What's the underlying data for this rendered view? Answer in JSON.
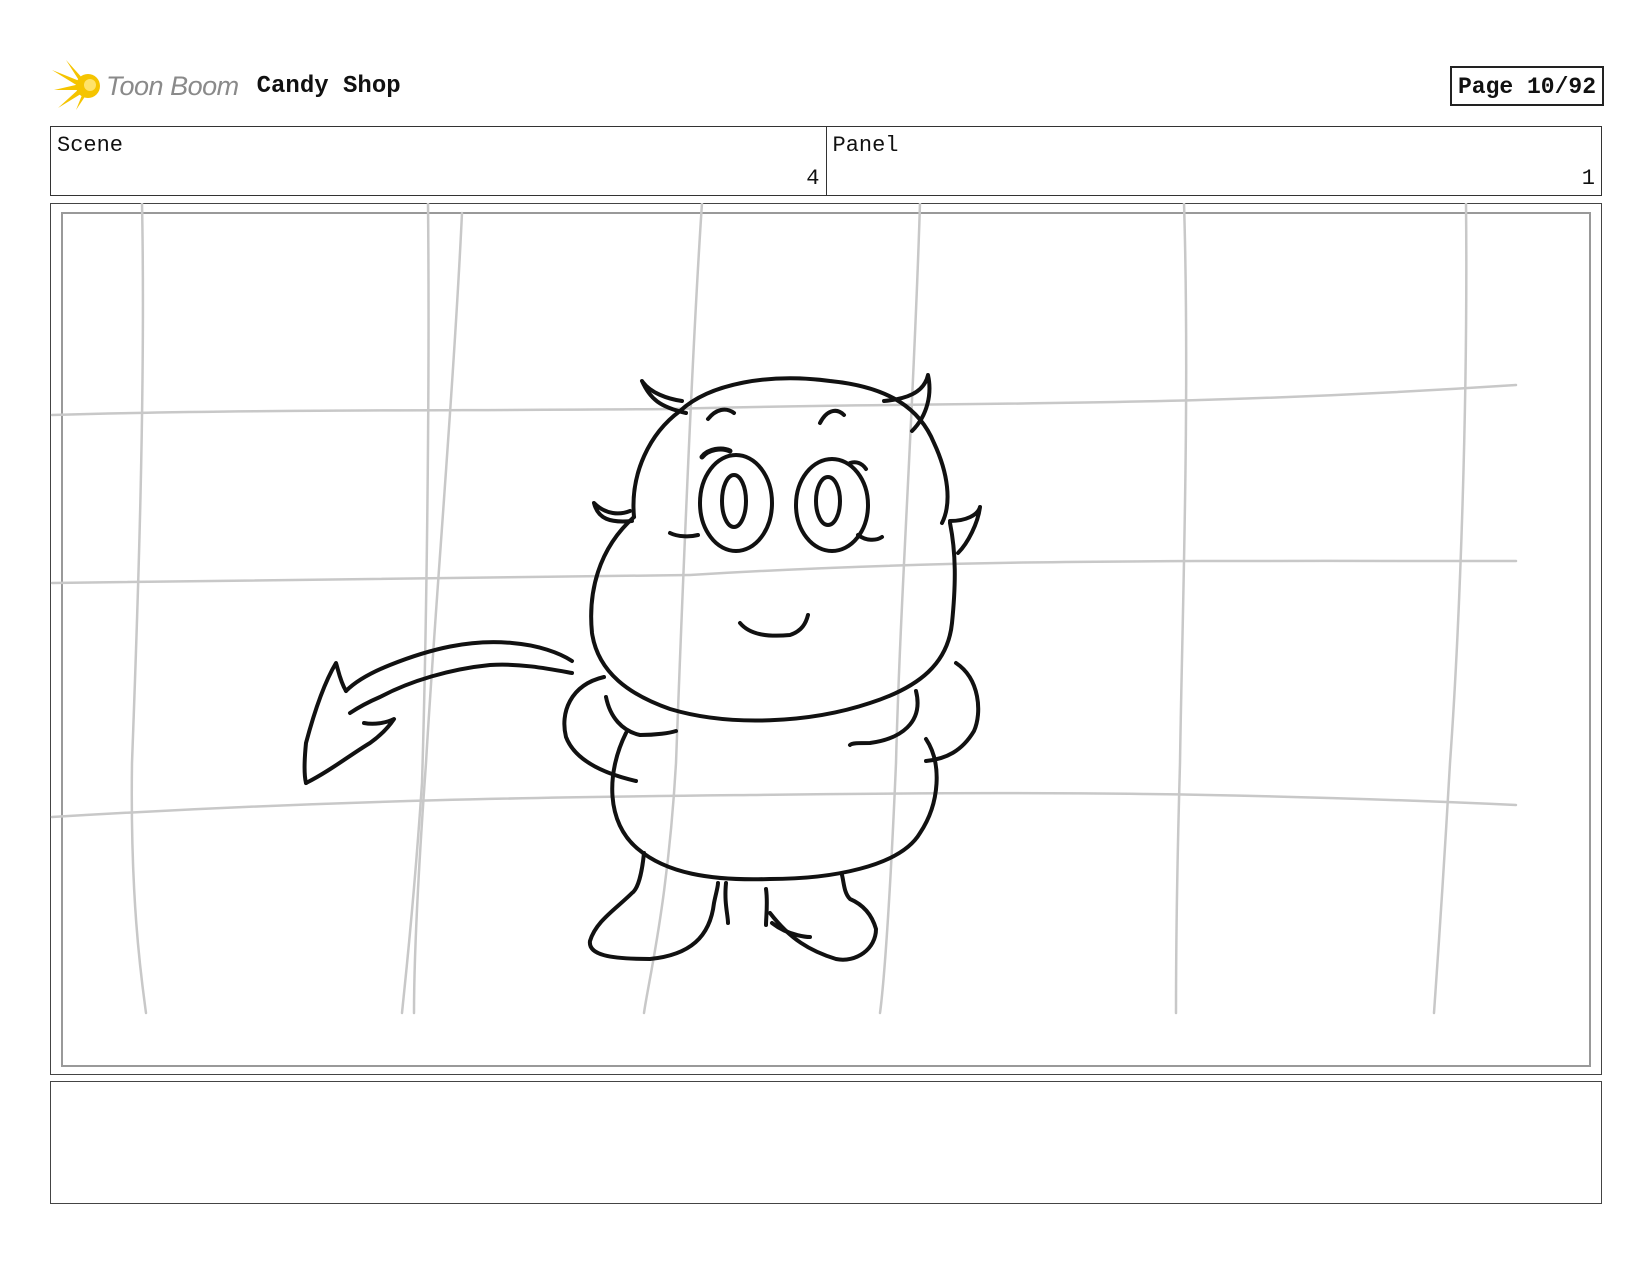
{
  "header": {
    "logo_text": "Toon Boom",
    "project_title": "Candy Shop",
    "page_label": "Page 10/92"
  },
  "info": {
    "scene_label": "Scene",
    "scene_value": "4",
    "panel_label": "Panel",
    "panel_value": "1"
  },
  "panel": {
    "drawing": "sketch-devil-character-icon"
  },
  "notes": {
    "text": ""
  },
  "colors": {
    "logo_accent": "#F5C400",
    "logo_text": "#8a8a8a",
    "grid_lines": "#c8c8c8",
    "ink": "#111111"
  }
}
